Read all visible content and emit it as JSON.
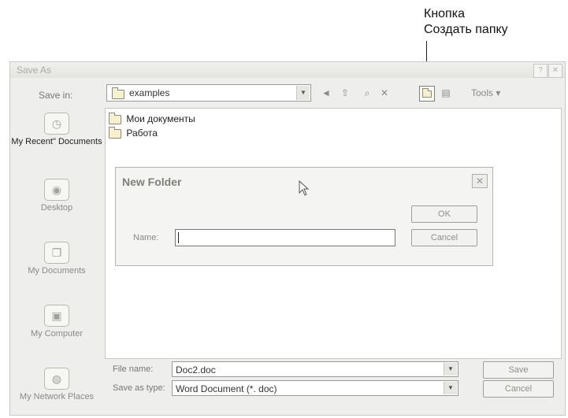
{
  "callout": {
    "line1": "Кнопка",
    "line2": "Создать папку"
  },
  "window": {
    "title": "Save As",
    "help_glyph": "?",
    "close_glyph": "✕"
  },
  "save_in": {
    "label": "Save in:",
    "value": "examples"
  },
  "toolbar": {
    "back_glyph": "◄",
    "up_glyph": "⇧",
    "search_glyph": "⌕",
    "delete_glyph": "✕",
    "views_glyph": "▤",
    "tools_label": "Tools"
  },
  "places": [
    {
      "label": "My Recent\" Documents"
    },
    {
      "label": "Desktop"
    },
    {
      "label": "My Documents"
    },
    {
      "label": "My Computer"
    },
    {
      "label": "My Network Places"
    }
  ],
  "files": [
    {
      "name": "Мои документы"
    },
    {
      "name": "Работа"
    }
  ],
  "new_folder": {
    "title": "New Folder",
    "name_label": "Name:",
    "name_value": "",
    "ok_label": "OK",
    "cancel_label": "Cancel"
  },
  "file_name": {
    "label": "File name:",
    "value": "Doc2.doc"
  },
  "save_as_type": {
    "label": "Save as type:",
    "value": "Word Document (*. doc)"
  },
  "buttons": {
    "save": "Save",
    "cancel": "Cancel"
  }
}
